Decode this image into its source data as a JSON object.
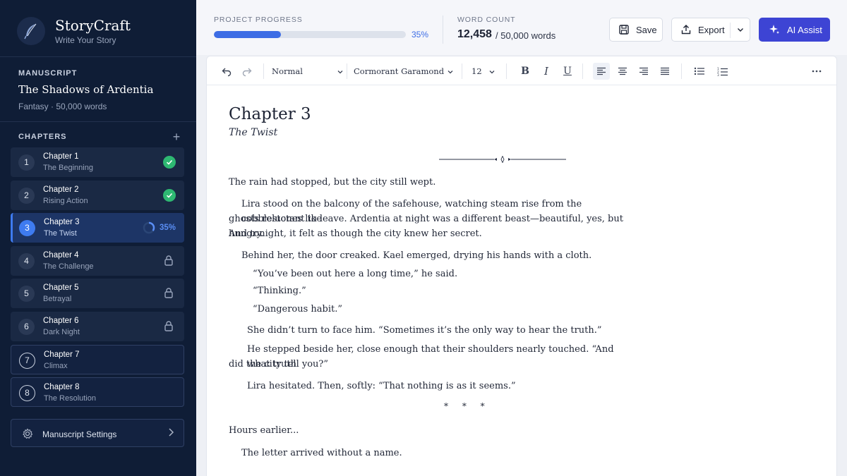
{
  "sidebar": {
    "brand_name": "StoryCraft",
    "brand_tagline": "Write Your Story",
    "manuscript_label": "MANUSCRIPT",
    "manuscript_title": "The Shadows of Ardentia",
    "manuscript_meta": "Fantasy · 50,000 words",
    "chapters_label": "CHAPTERS",
    "chapters": [
      {
        "num": "1",
        "title": "Chapter 1",
        "subtitle": "The Beginning",
        "status": "complete"
      },
      {
        "num": "2",
        "title": "Chapter 2",
        "subtitle": "Rising Action",
        "status": "complete"
      },
      {
        "num": "3",
        "title": "Chapter 3",
        "subtitle": "The Twist",
        "status": "in-progress",
        "progress_label": "35%",
        "progress": 0.35
      },
      {
        "num": "4",
        "title": "Chapter 4",
        "subtitle": "The Challenge",
        "status": "locked"
      },
      {
        "num": "5",
        "title": "Chapter 5",
        "subtitle": "Betrayal",
        "status": "locked"
      },
      {
        "num": "6",
        "title": "Chapter 6",
        "subtitle": "Dark Night",
        "status": "locked"
      },
      {
        "num": "7",
        "title": "Chapter 7",
        "subtitle": "Climax",
        "status": "open"
      },
      {
        "num": "8",
        "title": "Chapter 8",
        "subtitle": "The Resolution",
        "status": "open"
      }
    ],
    "settings_label": "Manuscript Settings"
  },
  "header": {
    "progress_label": "PROJECT PROGRESS",
    "progress_value": "35%",
    "progress_fraction": 0.35,
    "word_count_label": "WORD COUNT",
    "word_count": "12,458",
    "word_total": "/ 50,000 words",
    "save_label": "Save",
    "export_label": "Export",
    "ai_label": "AI Assist"
  },
  "toolbar": {
    "style_value": "Normal",
    "font_value": "Cormorant Garamond",
    "size_value": "12"
  },
  "document": {
    "chapter_title": "Chapter 3",
    "chapter_subtitle": "The Twist",
    "paragraphs": [
      "The rain had stopped, but the city still wept.",
      "Lira stood on the balcony of the safehouse, watching steam rise from the cobblestones like",
      "ghosts reluctant to leave. Ardentia at night was a different beast—beautiful, yes, but hungry.",
      "And tonight, it felt as though the city knew her secret.",
      "Behind her, the door creaked. Kael emerged, drying his hands with a cloth.",
      "“You’ve been out here a long time,” he said.",
      "“Thinking.”",
      "“Dangerous habit.”",
      "She didn’t turn to face him. “Sometimes it’s the only way to hear the truth.”",
      "He stepped beside her, close enough that their shoulders nearly touched. “And what truth",
      "did the city tell you?”",
      "Lira hesitated. Then, softly: “That nothing is as it seems.”",
      "Hours earlier...",
      "The letter arrived without a name."
    ],
    "scene_break": "* * *"
  },
  "colors": {
    "sidebar_bg": "#0f1d36",
    "accent": "#3d6de5",
    "ai_button": "#3d44d4",
    "complete": "#2eb872"
  }
}
